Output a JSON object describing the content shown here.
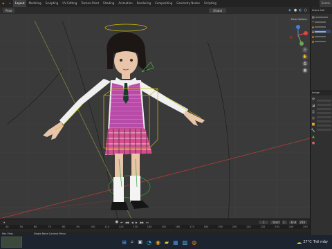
{
  "topbar": {
    "tabs": [
      "Layout",
      "Modeling",
      "Sculpting",
      "UV Editing",
      "Texture Paint",
      "Shading",
      "Animation",
      "Rendering",
      "Compositing",
      "Geometry Nodes",
      "Scripting"
    ],
    "active_tab": 0,
    "scene_label": "Scene"
  },
  "viewport_header": {
    "mode": "Pose",
    "orientation": "Global",
    "pose_options": "Pose Options"
  },
  "right_panel": {
    "outliner_header": "Scene Coll",
    "properties_header": "Image"
  },
  "timeline": {
    "ticks": [
      "40",
      "50",
      "60",
      "70",
      "80",
      "90",
      "100",
      "110",
      "120",
      "130",
      "140",
      "150",
      "160",
      "170",
      "180",
      "190",
      "200",
      "210",
      "220",
      "230",
      "240",
      "250"
    ],
    "current_frame": "1",
    "start_label": "Start",
    "start_value": "1",
    "end_label": "End",
    "end_value": "250"
  },
  "statusbar": {
    "left_text": "Pan View",
    "mid_text": "Single Bone Context Menu"
  },
  "taskbar": {
    "temperature": "27°C",
    "weather": "Trời mây",
    "icons": [
      "windows-start-icon",
      "search-icon",
      "task-view-icon",
      "edge-icon",
      "chrome-icon",
      "explorer-icon",
      "store-icon",
      "photos-icon",
      "blender-icon"
    ]
  },
  "colors": {
    "vest": "#b84ba8",
    "skirt": "#d0508a",
    "accent": "#4772b3",
    "bone_outline": "#c8c000"
  }
}
